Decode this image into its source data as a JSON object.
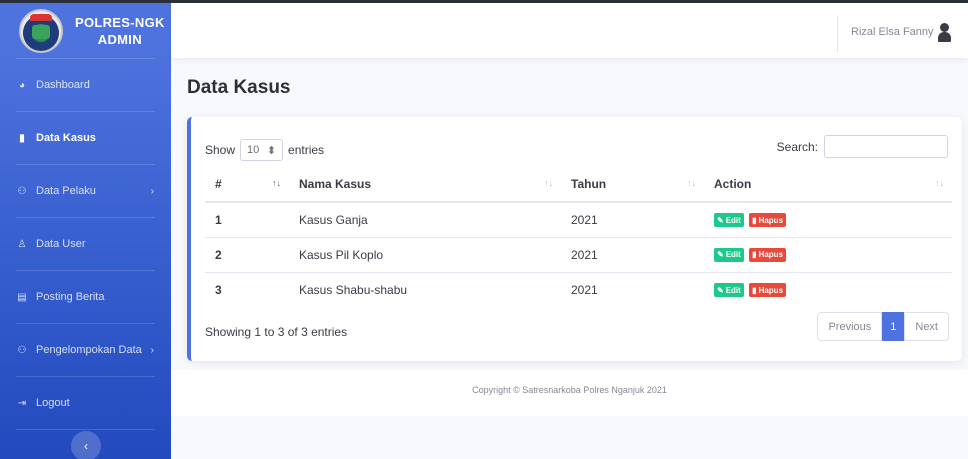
{
  "brand": {
    "line1": "POLRES-NGK",
    "line2": "ADMIN",
    "logo_text": "RESNARKOBA POLRES"
  },
  "sidebar": {
    "items": [
      {
        "label": "Dashboard",
        "icon": "dashboard-icon"
      },
      {
        "label": "Data Kasus",
        "icon": "file-icon",
        "active": true
      },
      {
        "label": "Data Pelaku",
        "icon": "users-icon",
        "has_submenu": true
      },
      {
        "label": "Data User",
        "icon": "user-icon"
      },
      {
        "label": "Posting Berita",
        "icon": "newspaper-icon"
      },
      {
        "label": "Pengelompokan Data",
        "icon": "users-icon",
        "has_submenu": true
      },
      {
        "label": "Logout",
        "icon": "logout-icon"
      }
    ],
    "toggle_glyph": "‹"
  },
  "topbar": {
    "user_name": "Rizal Elsa Fanny"
  },
  "page": {
    "title": "Data Kasus"
  },
  "table_controls": {
    "show_label": "Show",
    "entries_value": "10",
    "entries_label": "entries",
    "search_label": "Search:",
    "search_value": ""
  },
  "table": {
    "columns": [
      "#",
      "Nama Kasus",
      "Tahun",
      "Action"
    ],
    "rows": [
      {
        "num": "1",
        "name": "Kasus Ganja",
        "year": "2021"
      },
      {
        "num": "2",
        "name": "Kasus Pil Koplo",
        "year": "2021"
      },
      {
        "num": "3",
        "name": "Kasus Shabu-shabu",
        "year": "2021"
      }
    ],
    "edit_label": "Edit",
    "delete_label": "Hapus",
    "sort_glyph": "↑↓"
  },
  "pagination": {
    "info": "Showing 1 to 3 of 3 entries",
    "previous": "Previous",
    "current": "1",
    "next": "Next"
  },
  "footer": {
    "copyright": "Copyright © Satresnarkoba Polres Nganjuk 2021"
  },
  "colors": {
    "primary": "#4e73df",
    "success": "#1cc88a",
    "danger": "#e74a3b"
  }
}
